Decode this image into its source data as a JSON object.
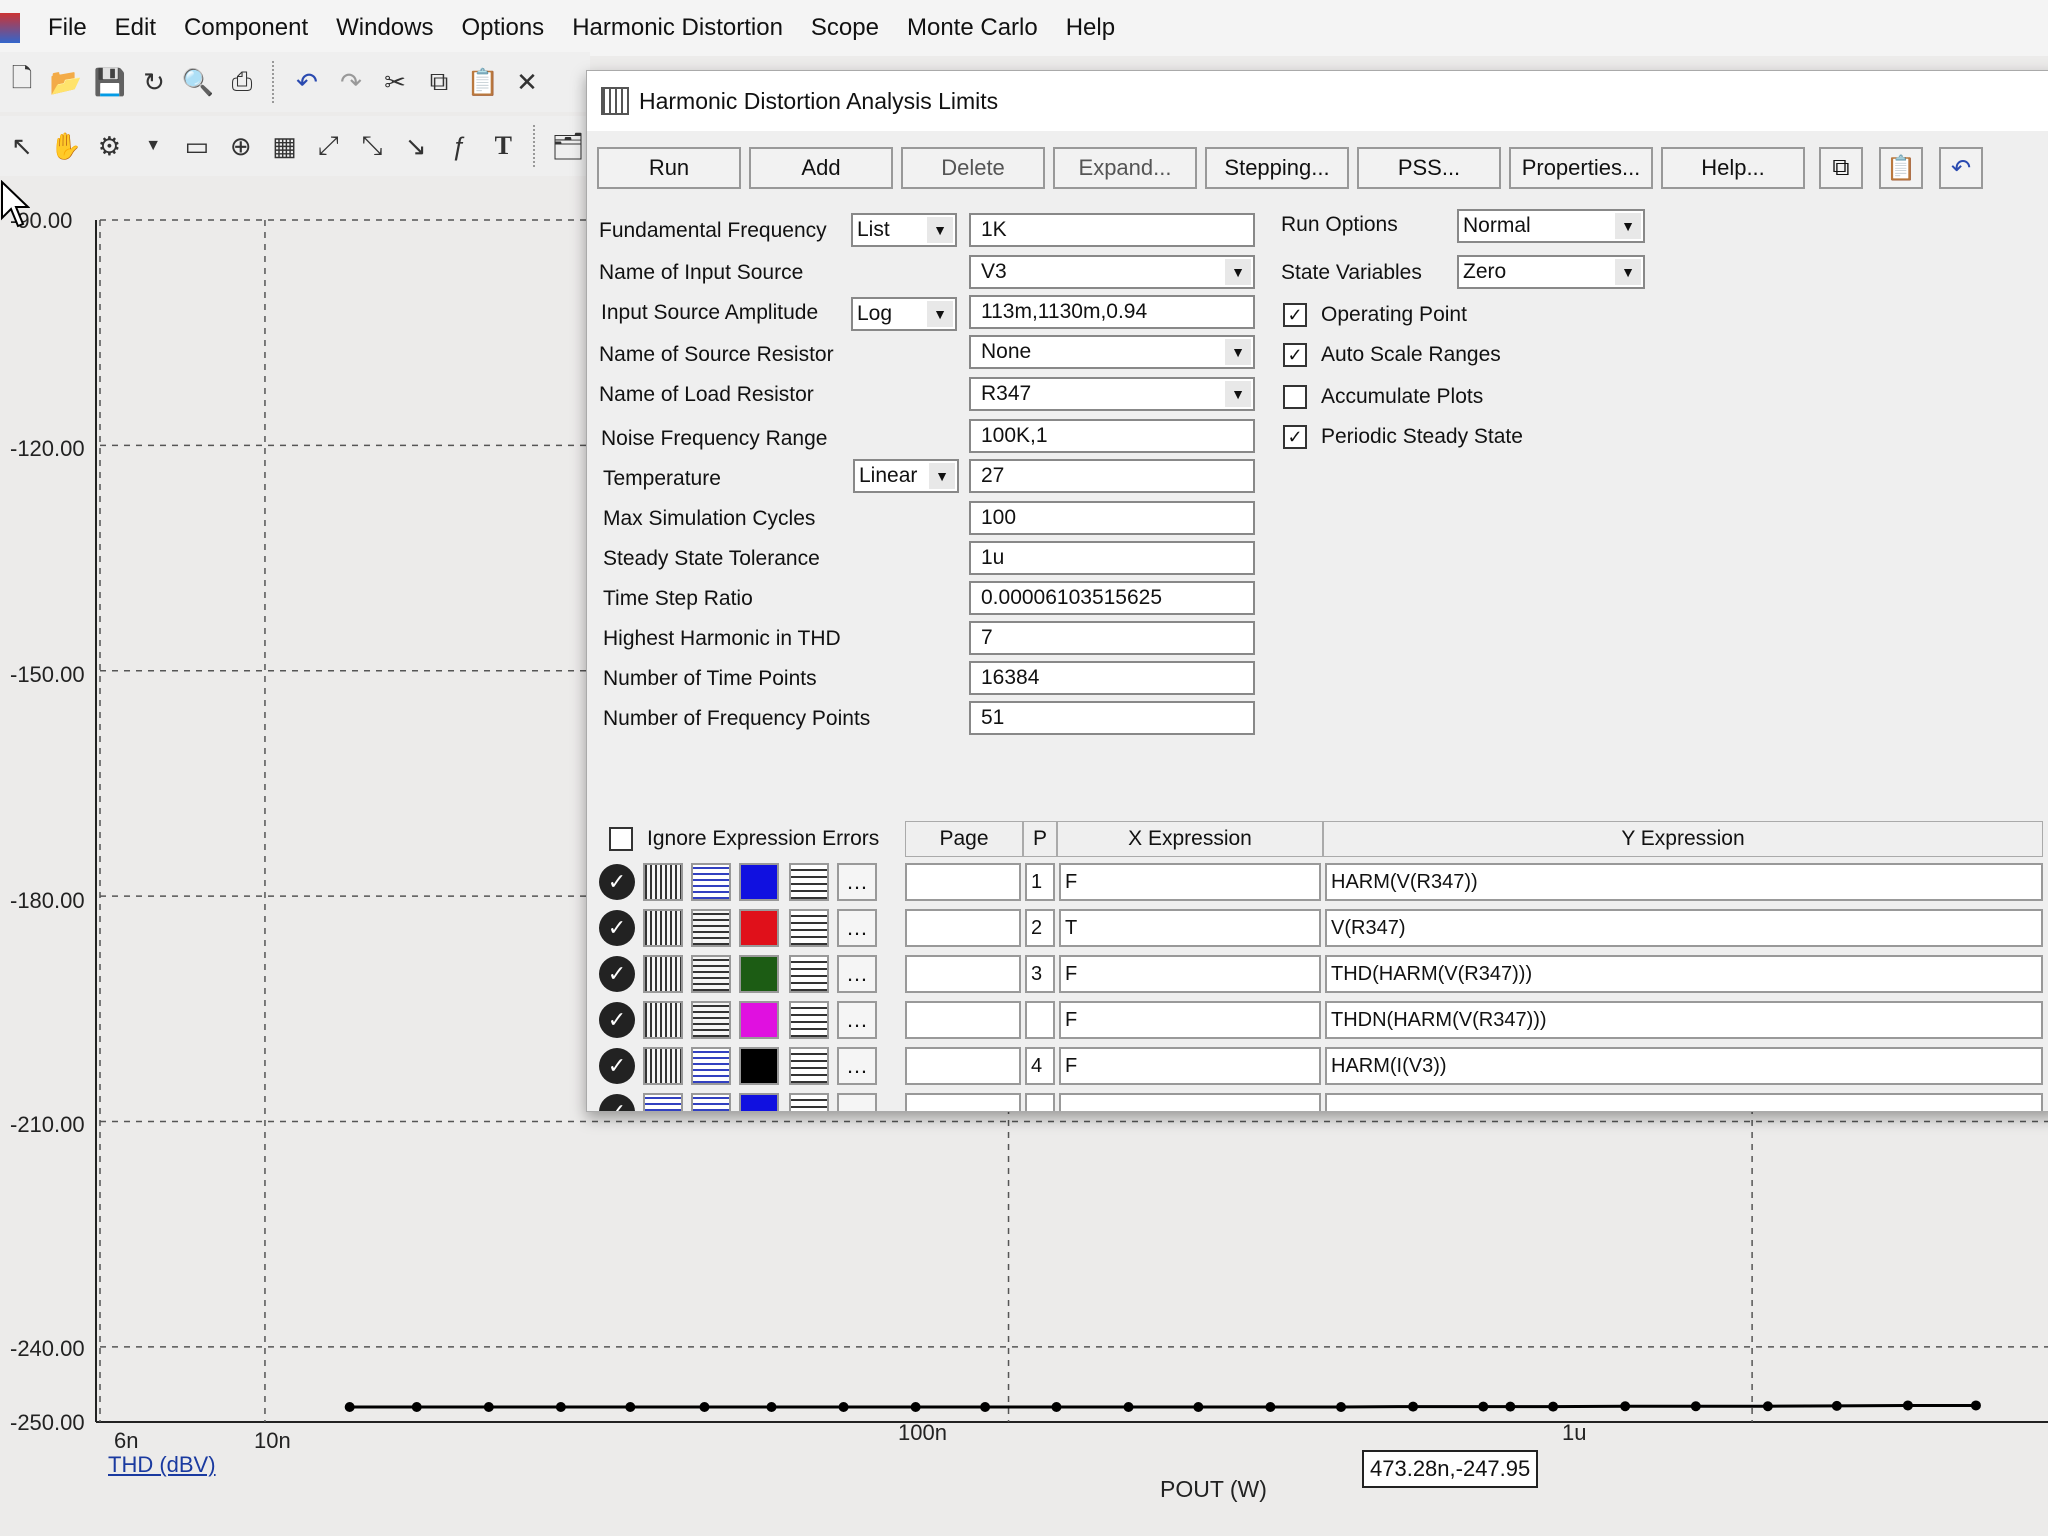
{
  "menu": [
    "File",
    "Edit",
    "Component",
    "Windows",
    "Options",
    "Harmonic Distortion",
    "Scope",
    "Monte Carlo",
    "Help"
  ],
  "plot": {
    "y_ticks": [
      "-90.00",
      "-120.00",
      "-150.00",
      "-180.00",
      "-210.00",
      "-240.00",
      "-250.00"
    ],
    "x_ticks": [
      "6n",
      "10n",
      "100n",
      "1u"
    ],
    "y_label": "THD (dBV)",
    "x_label": "POUT (W)",
    "cursor_readout": "473.28n,-247.95"
  },
  "chart_data": {
    "type": "line",
    "xscale": "log",
    "xlim": [
      6e-09,
      2.5e-06
    ],
    "ylim": [
      -250,
      -90
    ],
    "xlabel": "POUT (W)",
    "ylabel": "THD (dBV)",
    "grid": true,
    "series": [
      {
        "color": "#000000",
        "x": [
          1.3e-08,
          1.6e-08,
          2e-08,
          2.5e-08,
          3.1e-08,
          3.9e-08,
          4.8e-08,
          6e-08,
          7.5e-08,
          9.3e-08,
          1.16e-07,
          1.45e-07,
          1.8e-07,
          2.25e-07,
          2.8e-07,
          3.5e-07,
          4.35e-07,
          4.73e-07,
          5.4e-07,
          6.75e-07,
          8.4e-07,
          1.05e-06,
          1.3e-06,
          1.62e-06,
          2e-06
        ],
        "y": [
          -248.0,
          -248.0,
          -248.0,
          -248.0,
          -248.0,
          -248.0,
          -248.0,
          -248.0,
          -248.0,
          -248.0,
          -248.0,
          -248.0,
          -248.0,
          -248.0,
          -248.0,
          -247.95,
          -247.95,
          -247.95,
          -247.95,
          -247.9,
          -247.9,
          -247.9,
          -247.85,
          -247.8,
          -247.8
        ]
      }
    ]
  },
  "dialog": {
    "title": "Harmonic Distortion Analysis Limits",
    "buttons": {
      "run": "Run",
      "add": "Add",
      "delete": "Delete",
      "expand": "Expand...",
      "stepping": "Stepping...",
      "pss": "PSS...",
      "properties": "Properties...",
      "help": "Help..."
    },
    "fields": {
      "fundamental_frequency": {
        "label": "Fundamental Frequency",
        "mode": "List",
        "value": "1K"
      },
      "input_source": {
        "label": "Name of Input Source",
        "value": "V3"
      },
      "input_amplitude": {
        "label": "Input Source Amplitude",
        "mode": "Log",
        "value": "113m,1130m,0.94"
      },
      "source_resistor": {
        "label": "Name of Source Resistor",
        "value": "None"
      },
      "load_resistor": {
        "label": "Name of Load Resistor",
        "value": "R347"
      },
      "noise_range": {
        "label": "Noise Frequency Range",
        "value": "100K,1"
      },
      "temperature": {
        "label": "Temperature",
        "mode": "Linear",
        "value": "27"
      },
      "max_cycles": {
        "label": "Max Simulation Cycles",
        "value": "100"
      },
      "steady_tol": {
        "label": "Steady State Tolerance",
        "value": "1u"
      },
      "time_step": {
        "label": "Time Step Ratio",
        "value": "0.00006103515625"
      },
      "highest_harmonic": {
        "label": "Highest Harmonic in THD",
        "value": "7"
      },
      "time_points": {
        "label": "Number of Time Points",
        "value": "16384"
      },
      "freq_points": {
        "label": "Number of Frequency Points",
        "value": "51"
      }
    },
    "run_options": {
      "label": "Run Options",
      "value": "Normal"
    },
    "state_variables": {
      "label": "State Variables",
      "value": "Zero"
    },
    "checks": {
      "operating_point": {
        "label": "Operating Point",
        "checked": "✓"
      },
      "auto_scale": {
        "label": "Auto Scale Ranges",
        "checked": "✓"
      },
      "accumulate": {
        "label": "Accumulate Plots",
        "checked": ""
      },
      "pss": {
        "label": "Periodic Steady State",
        "checked": "✓"
      }
    },
    "grid": {
      "ignore_errors": "Ignore Expression Errors",
      "col_page": "Page",
      "col_p": "P",
      "col_x": "X Expression",
      "col_y": "Y Expression",
      "rows": [
        {
          "p": "1",
          "x": "F",
          "y": "HARM(V(R347))",
          "color": "#1010e0"
        },
        {
          "p": "2",
          "x": "T",
          "y": "V(R347)",
          "color": "#e0101a"
        },
        {
          "p": "3",
          "x": "F",
          "y": "THD(HARM(V(R347)))",
          "color": "#1c5c14"
        },
        {
          "p": "",
          "x": "F",
          "y": "THDN(HARM(V(R347)))",
          "color": "#e010e0"
        },
        {
          "p": "4",
          "x": "F",
          "y": "HARM(I(V3))",
          "color": "#000000"
        },
        {
          "p": "",
          "x": "",
          "y": "",
          "color": "#1010e0"
        }
      ]
    }
  }
}
